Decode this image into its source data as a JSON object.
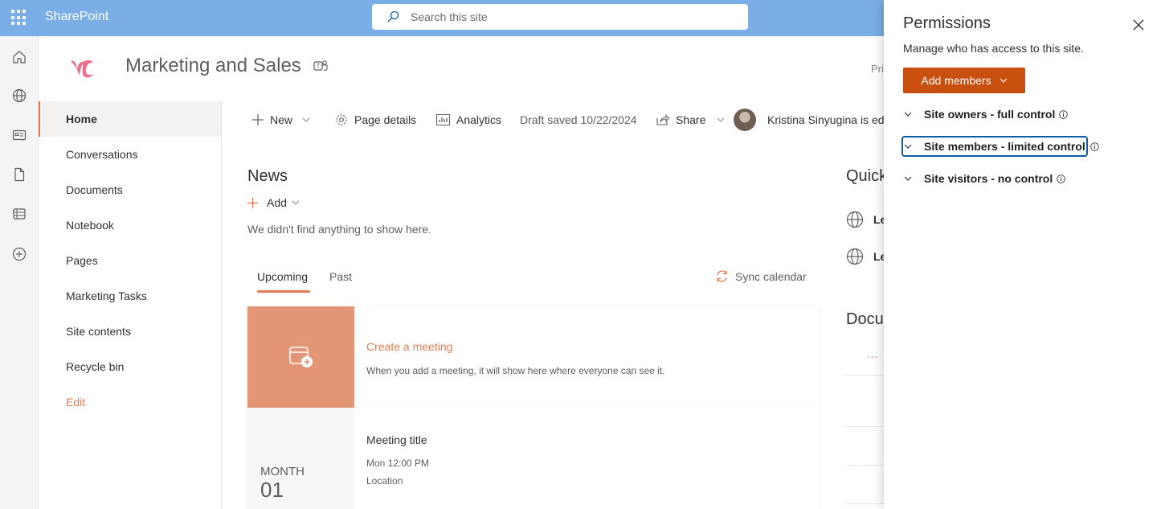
{
  "topbar": {
    "app_name": "SharePoint",
    "search_placeholder": "Search this site"
  },
  "site": {
    "title": "Marketing and Sales",
    "privacy_partial": "Pri"
  },
  "nav": {
    "items": [
      {
        "label": "Home",
        "active": true
      },
      {
        "label": "Conversations"
      },
      {
        "label": "Documents"
      },
      {
        "label": "Notebook"
      },
      {
        "label": "Pages"
      },
      {
        "label": "Marketing Tasks"
      },
      {
        "label": "Site contents"
      },
      {
        "label": "Recycle bin"
      },
      {
        "label": "Edit"
      }
    ]
  },
  "commandbar": {
    "new": "New",
    "page_details": "Page details",
    "analytics": "Analytics",
    "draft_status": "Draft saved 10/22/2024",
    "share": "Share",
    "editing_status": "Kristina Sinyugina is edi"
  },
  "news": {
    "title": "News",
    "add": "Add",
    "empty": "We didn't find anything to show here."
  },
  "events": {
    "tabs": [
      "Upcoming",
      "Past"
    ],
    "sync": "Sync calendar",
    "create_title": "Create a meeting",
    "create_desc": "When you add a meeting, it will show here where everyone can see it.",
    "sample": {
      "month": "MONTH",
      "day": "01",
      "title": "Meeting title",
      "time": "Mon 12:00 PM",
      "location": "Location"
    }
  },
  "right_column": {
    "quick_links": "Quick",
    "links": [
      "Le",
      "Le"
    ],
    "documents": "Docu",
    "more": "..."
  },
  "panel": {
    "title": "Permissions",
    "subtitle": "Manage who has access to this site.",
    "add_members": "Add members",
    "groups": [
      {
        "label": "Site owners - full control"
      },
      {
        "label": "Site members - limited control",
        "focused": true
      },
      {
        "label": "Site visitors - no control"
      }
    ]
  },
  "colors": {
    "topbar": "#79aee6",
    "accent": "#e07b54",
    "primary_button": "#c94f0f",
    "focus": "#0f5ba7"
  }
}
